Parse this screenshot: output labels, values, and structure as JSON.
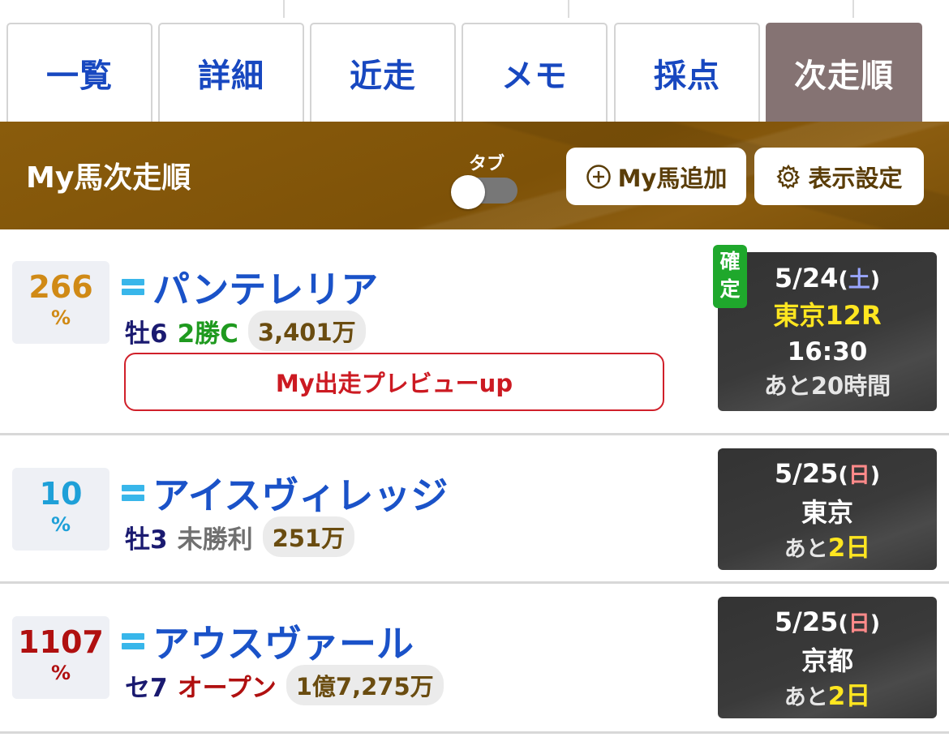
{
  "tabs": [
    "一覧",
    "詳細",
    "近走",
    "メモ",
    "採点",
    "次走順"
  ],
  "header": {
    "title": "My馬次走順",
    "toggle_label": "タブ",
    "add_button": "My馬追加",
    "settings_button": "表示設定"
  },
  "horses": [
    {
      "pct": "266",
      "pct_unit": "%",
      "pct_color": "#d08a16",
      "name": "パンテレリア",
      "sex_age": "牡6",
      "class": "2勝C",
      "class_color": "#1f9a1f",
      "prize": "3,401万",
      "preview": "My出走プレビューup",
      "badge": "確定",
      "race": {
        "date": "5/24",
        "dow_open": "(",
        "dow": "土",
        "dow_close": ")",
        "dow_color": "#9aa6ff",
        "venue": "東京12R",
        "time": "16:30",
        "remain_prefix": "あと20時間",
        "remain_value": ""
      }
    },
    {
      "pct": "10",
      "pct_unit": "%",
      "pct_color": "#1ea0d8",
      "name": "アイスヴィレッジ",
      "sex_age": "牡3",
      "class": "未勝利",
      "class_color": "#707070",
      "prize": "251万",
      "race": {
        "date": "5/25",
        "dow_open": "(",
        "dow": "日",
        "dow_close": ")",
        "dow_color": "#ff8a8a",
        "venue": "東京",
        "remain_prefix": "あと",
        "remain_value": "2日"
      }
    },
    {
      "pct": "1107",
      "pct_unit": "%",
      "pct_color": "#b01010",
      "name": "アウスヴァール",
      "sex_age": "セ7",
      "class": "オープン",
      "class_color": "#b01010",
      "prize": "1億7,275万",
      "race": {
        "date": "5/25",
        "dow_open": "(",
        "dow": "日",
        "dow_close": ")",
        "dow_color": "#ff8a8a",
        "venue": "京都",
        "remain_prefix": "あと",
        "remain_value": "2日"
      }
    }
  ]
}
